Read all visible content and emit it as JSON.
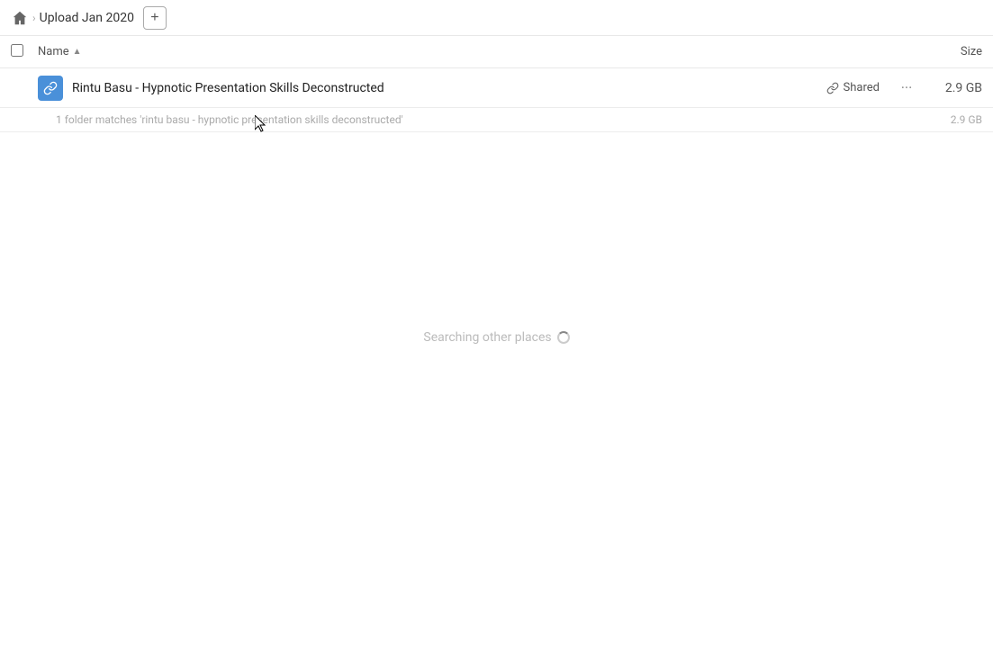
{
  "header": {
    "home_label": "Home",
    "breadcrumb_label": "Upload Jan 2020",
    "add_button_label": "+"
  },
  "columns": {
    "name_label": "Name",
    "sort_indicator": "▲",
    "size_label": "Size"
  },
  "file_row": {
    "name": "Rintu Basu - Hypnotic Presentation Skills Deconstructed",
    "shared_label": "Shared",
    "more_label": "···",
    "size": "2.9 GB"
  },
  "match_row": {
    "text": "1 folder matches 'rintu basu - hypnotic presentation skills deconstructed'",
    "size": "2.9 GB"
  },
  "searching": {
    "text": "Searching other places"
  }
}
